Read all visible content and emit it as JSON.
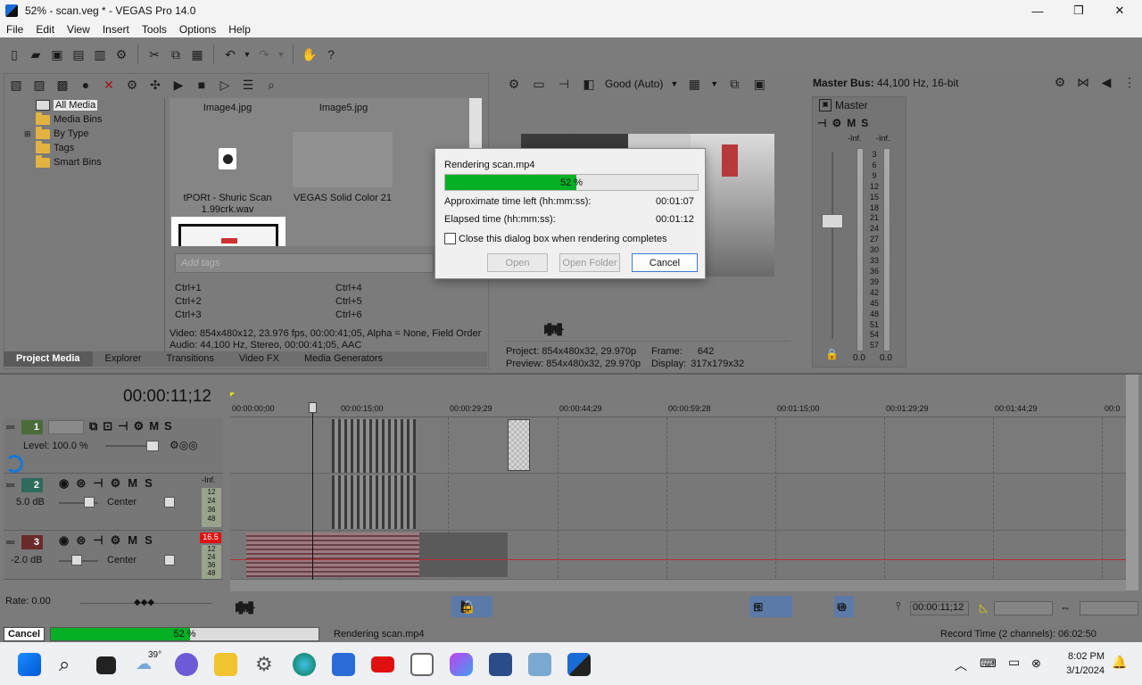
{
  "window": {
    "title": "52% - scan.veg * - VEGAS Pro 14.0"
  },
  "menu": [
    "File",
    "Edit",
    "View",
    "Insert",
    "Tools",
    "Options",
    "Help"
  ],
  "media": {
    "tree": [
      "All Media",
      "Media Bins",
      "By Type",
      "Tags",
      "Smart Bins"
    ],
    "thumbs": {
      "img4": "Image4.jpg",
      "img5": "Image5.jpg",
      "wav": "tPORt - Shuric Scan 1.99crk.wav",
      "solid": "VEGAS Solid Color 21"
    },
    "tags_placeholder": "Add tags",
    "hotkeys": [
      "Ctrl+1",
      "Ctrl+2",
      "Ctrl+3",
      "Ctrl+4",
      "Ctrl+5",
      "Ctrl+6"
    ],
    "video_info": "Video: 854x480x12, 23.976 fps, 00:00:41;05, Alpha = None, Field Order",
    "audio_info": "Audio: 44,100 Hz, Stereo, 00:00:41;05, AAC"
  },
  "tabs": [
    "Project Media",
    "Explorer",
    "Transitions",
    "Video FX",
    "Media Generators"
  ],
  "preview": {
    "quality": "Good (Auto)",
    "project": "Project:  854x480x32, 29.970p",
    "preview": "Preview:  854x480x32, 29.970p",
    "frame": "Frame:",
    "frame_val": "642",
    "display": "Display:",
    "display_val": "317x179x32"
  },
  "master": {
    "title": "Master Bus:",
    "info": "44,100 Hz, 16-bit",
    "label": "Master",
    "m": "M",
    "s": "S",
    "inf1": "-Inf.",
    "inf2": "-Inf.",
    "scale": [
      "3",
      "6",
      "9",
      "12",
      "15",
      "18",
      "21",
      "24",
      "27",
      "30",
      "33",
      "36",
      "39",
      "42",
      "45",
      "48",
      "51",
      "54",
      "57"
    ],
    "v1": "0.0",
    "v2": "0.0"
  },
  "timeline": {
    "time": "00:00:11;12",
    "ruler": [
      "00:00:00;00",
      "00:00:15;00",
      "00:00:29;29",
      "00:00:44;29",
      "00:00:59;28",
      "00:01:15;00",
      "00:01:29;29",
      "00:01:44;29",
      "00:0"
    ],
    "track1": {
      "num": "1",
      "level": "Level: 100.0 %"
    },
    "track2": {
      "num": "2",
      "db": "5.0 dB",
      "pan": "Center"
    },
    "track3": {
      "num": "3",
      "db": "-2.0 dB",
      "pan": "Center",
      "peak": "16.5"
    },
    "m": "M",
    "s": "S",
    "meter_inf": "-Inf.",
    "meter_scale": [
      "12",
      "24",
      "36",
      "48"
    ],
    "rate": "Rate: 0.00",
    "cursor_time": "00:00:11;12"
  },
  "dialog": {
    "title": "Rendering scan.mp4",
    "progress_pct": 52,
    "progress_label": "52 %",
    "time_left_label": "Approximate time left (hh:mm:ss):",
    "time_left": "00:01:07",
    "elapsed_label": "Elapsed time (hh:mm:ss):",
    "elapsed": "00:01:12",
    "checkbox": "Close this dialog box when rendering completes",
    "open": "Open",
    "open_folder": "Open Folder",
    "cancel": "Cancel"
  },
  "status": {
    "cancel": "Cancel",
    "progress_pct": 52,
    "progress_label": "52 %",
    "message": "Rendering scan.mp4",
    "record": "Record Time (2 channels): 06:02:50"
  },
  "taskbar": {
    "weather": "39°",
    "time": "8:02 PM",
    "date": "3/1/2024"
  }
}
